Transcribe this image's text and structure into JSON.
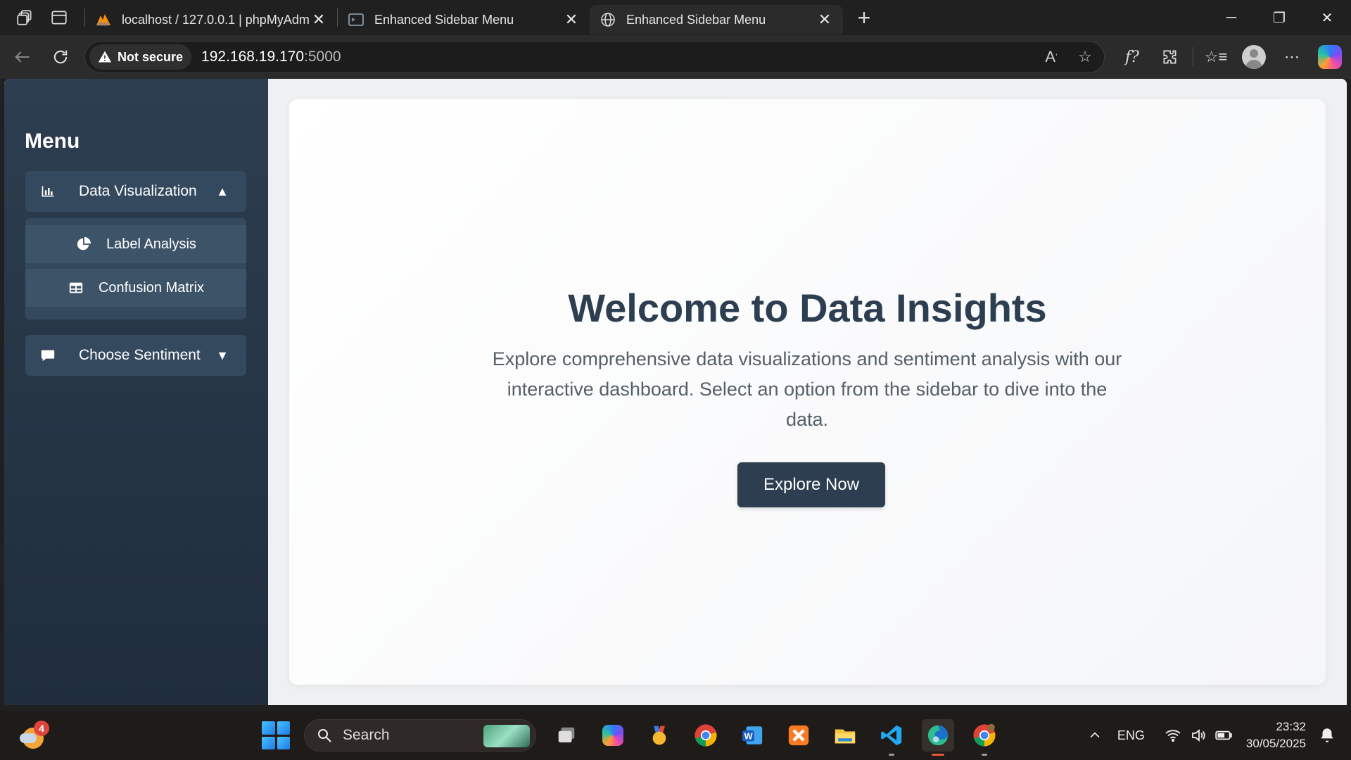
{
  "browser": {
    "tabs": [
      {
        "label": "localhost / 127.0.0.1 | phpMyAdm",
        "icon": "phpmyadmin-icon",
        "active": false
      },
      {
        "label": "Enhanced Sidebar Menu",
        "icon": "terminal-page-icon",
        "active": false
      },
      {
        "label": "Enhanced Sidebar Menu",
        "icon": "globe-icon",
        "active": true
      }
    ],
    "security_label": "Not secure",
    "url_host": "192.168.19.170",
    "url_port": ":5000"
  },
  "page": {
    "sidebar": {
      "title": "Menu",
      "dropdowns": [
        {
          "label": "Data Visualization",
          "icon": "bar-chart-icon",
          "caret": "▲",
          "expanded": true,
          "items": [
            {
              "label": "Label Analysis",
              "icon": "pie-chart-icon"
            },
            {
              "label": "Confusion Matrix",
              "icon": "table-icon"
            }
          ]
        },
        {
          "label": "Choose Sentiment",
          "icon": "comment-icon",
          "caret": "▼",
          "expanded": false
        }
      ]
    },
    "main": {
      "heading": "Welcome to Data Insights",
      "description": "Explore comprehensive data visualizations and sentiment analysis with our interactive dashboard. Select an option from the sidebar to dive into the data.",
      "cta_label": "Explore Now"
    },
    "colors": {
      "sidebar": "#2c3e50",
      "sidebar_button": "#34495e",
      "heading": "#2c3e50",
      "cta": "#2c3e50"
    }
  },
  "taskbar": {
    "weather_badge": "4",
    "search_placeholder": "Search",
    "apps": [
      "task-view-icon",
      "copilot-icon",
      "medal-icon",
      "chrome-icon",
      "word-icon",
      "xampp-icon",
      "file-explorer-icon",
      "vscode-icon",
      "edge-icon",
      "chrome-canary-icon"
    ],
    "language": "ENG",
    "time": "23:32",
    "date": "30/05/2025"
  }
}
